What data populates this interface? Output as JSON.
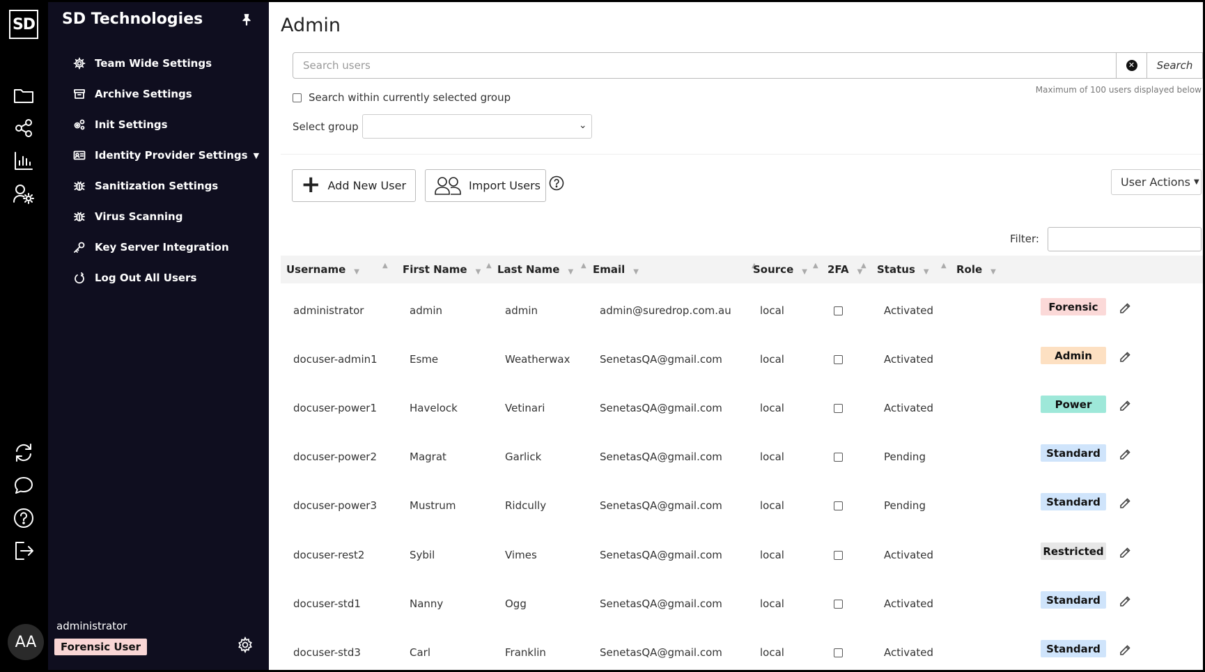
{
  "brand_logo": "SD",
  "app": {
    "company": "SD Technologies"
  },
  "rail": {
    "top_icons": [
      "folder-icon",
      "share-icon",
      "bar-chart-icon",
      "users-gear-icon"
    ],
    "bottom_icons": [
      "refresh-icon",
      "chat-icon",
      "help-icon",
      "logout-icon"
    ],
    "avatar_initials": "AA"
  },
  "sidebar": {
    "items": [
      {
        "label": "Team Wide Settings",
        "icon": "gear-icon"
      },
      {
        "label": "Archive Settings",
        "icon": "archive-icon"
      },
      {
        "label": "Init Settings",
        "icon": "cogs-icon"
      },
      {
        "label": "Identity Provider Settings",
        "icon": "id-card-icon",
        "has_dropdown": true
      },
      {
        "label": "Sanitization Settings",
        "icon": "bug-icon"
      },
      {
        "label": "Virus Scanning",
        "icon": "bug-icon"
      },
      {
        "label": "Key Server Integration",
        "icon": "key-icon"
      },
      {
        "label": "Log Out All Users",
        "icon": "power-icon"
      }
    ],
    "user": {
      "name": "administrator",
      "role": "Forensic User"
    }
  },
  "main": {
    "title": "Admin",
    "search": {
      "placeholder": "Search users",
      "button_label": "Search",
      "max_note": "Maximum of 100 users displayed below"
    },
    "within_group_label": "Search within currently selected group",
    "select_group_label": "Select group",
    "select_group_value": "",
    "add_user_label": "Add New User",
    "import_users_label": "Import Users",
    "user_actions_label": "User Actions",
    "filter_label": "Filter:"
  },
  "table": {
    "columns": [
      "Username",
      "First Name",
      "Last Name",
      "Email",
      "Source",
      "2FA",
      "Status",
      "Role"
    ],
    "rows": [
      {
        "username": "administrator",
        "first": "admin",
        "last": "admin",
        "email": "admin@suredrop.com.au",
        "source": "local",
        "status": "Activated",
        "role": "Forensic"
      },
      {
        "username": "docuser-admin1",
        "first": "Esme",
        "last": "Weatherwax",
        "email": "SenetasQA@gmail.com",
        "source": "local",
        "status": "Activated",
        "role": "Admin"
      },
      {
        "username": "docuser-power1",
        "first": "Havelock",
        "last": "Vetinari",
        "email": "SenetasQA@gmail.com",
        "source": "local",
        "status": "Activated",
        "role": "Power"
      },
      {
        "username": "docuser-power2",
        "first": "Magrat",
        "last": "Garlick",
        "email": "SenetasQA@gmail.com",
        "source": "local",
        "status": "Pending",
        "role": "Standard"
      },
      {
        "username": "docuser-power3",
        "first": "Mustrum",
        "last": "Ridcully",
        "email": "SenetasQA@gmail.com",
        "source": "local",
        "status": "Pending",
        "role": "Standard"
      },
      {
        "username": "docuser-rest2",
        "first": "Sybil",
        "last": "Vimes",
        "email": "SenetasQA@gmail.com",
        "source": "local",
        "status": "Activated",
        "role": "Restricted"
      },
      {
        "username": "docuser-std1",
        "first": "Nanny",
        "last": "Ogg",
        "email": "SenetasQA@gmail.com",
        "source": "local",
        "status": "Activated",
        "role": "Standard"
      },
      {
        "username": "docuser-std3",
        "first": "Carl",
        "last": "Franklin",
        "email": "SenetasQA@gmail.com",
        "source": "local",
        "status": "Activated",
        "role": "Standard"
      }
    ]
  },
  "role_colors": {
    "Forensic": "#fbd9d8",
    "Admin": "#fde0c2",
    "Power": "#9ee8d9",
    "Standard": "#cfe4fb",
    "Restricted": "#e7e7e7"
  }
}
